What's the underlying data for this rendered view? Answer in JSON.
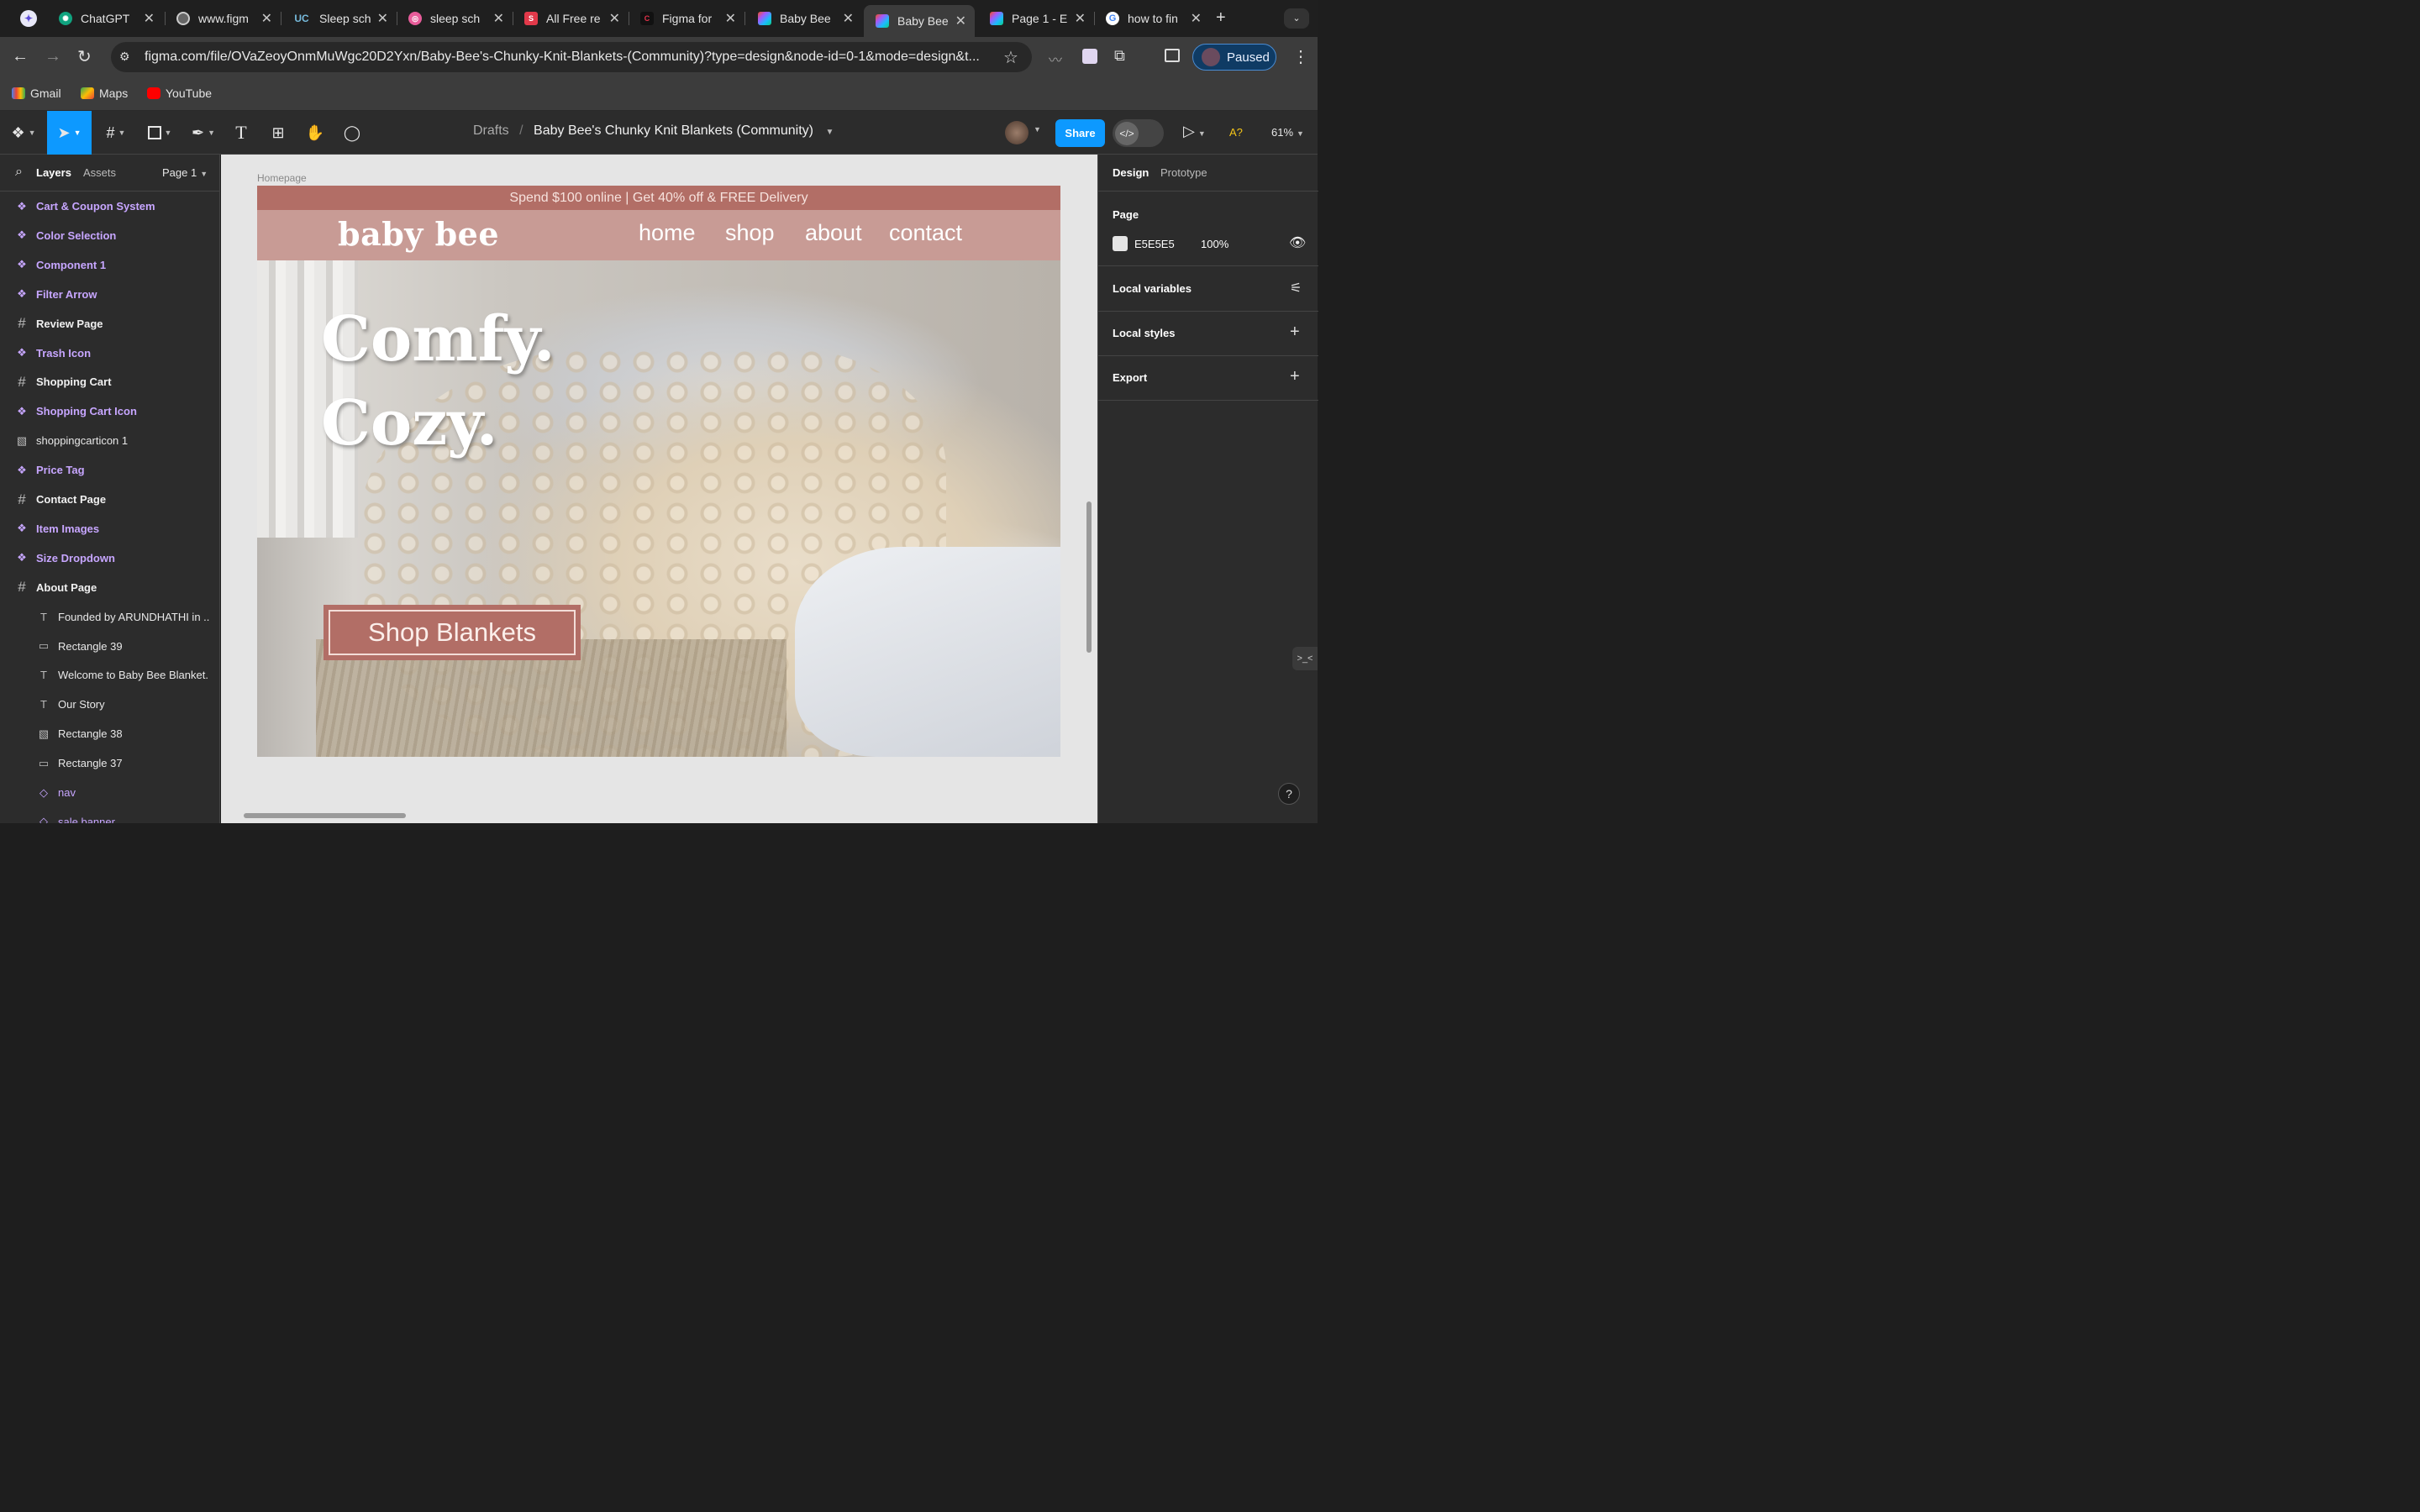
{
  "browser": {
    "tabs": [
      {
        "title": "ChatGPT",
        "color": "#10a37f"
      },
      {
        "title": "www.figm",
        "color": "#777777"
      },
      {
        "title": "Sleep sch",
        "color": "#1c1c1c"
      },
      {
        "title": "sleep sch",
        "color": "#e85c9a"
      },
      {
        "title": "All Free re",
        "color": "#e2394a"
      },
      {
        "title": "Figma for",
        "color": "#1a1a1a"
      },
      {
        "title": "Baby Bee",
        "color": "#a259ff"
      },
      {
        "title": "Baby Bee",
        "color": "#a259ff"
      },
      {
        "title": "Page 1 - E",
        "color": "#a259ff"
      },
      {
        "title": "how to fin",
        "color": "#4285f4"
      }
    ],
    "url": "figma.com/file/OVaZeoyOnmMuWgc20D2Yxn/Baby-Bee's-Chunky-Knit-Blankets-(Community)?type=design&node-id=0-1&mode=design&t...",
    "profile_status": "Paused",
    "bookmarks": [
      "Gmail",
      "Maps",
      "YouTube"
    ]
  },
  "figma": {
    "breadcrumb_root": "Drafts",
    "breadcrumb_sep": "/",
    "file_name": "Baby Bee's Chunky Knit Blankets (Community)",
    "share_label": "Share",
    "ai_label": "A?",
    "zoom": "61%",
    "left_tabs": {
      "layers": "Layers",
      "assets": "Assets",
      "page": "Page 1"
    },
    "layers": [
      {
        "name": "Cart & Coupon System",
        "icon": "component",
        "style": "purple"
      },
      {
        "name": "Color Selection",
        "icon": "component",
        "style": "purple"
      },
      {
        "name": "Component 1",
        "icon": "component",
        "style": "purple"
      },
      {
        "name": "Filter Arrow",
        "icon": "component",
        "style": "purple"
      },
      {
        "name": "Review Page",
        "icon": "frame",
        "style": "white"
      },
      {
        "name": "Trash Icon",
        "icon": "component",
        "style": "purple"
      },
      {
        "name": "Shopping Cart",
        "icon": "frame",
        "style": "white"
      },
      {
        "name": "Shopping Cart Icon",
        "icon": "component",
        "style": "purple"
      },
      {
        "name": "shoppingcarticon 1",
        "icon": "image",
        "style": "normal"
      },
      {
        "name": "Price Tag",
        "icon": "component",
        "style": "purple"
      },
      {
        "name": "Contact Page",
        "icon": "frame",
        "style": "white"
      },
      {
        "name": "Item Images",
        "icon": "component",
        "style": "purple"
      },
      {
        "name": "Size Dropdown",
        "icon": "component",
        "style": "purple"
      },
      {
        "name": "About Page",
        "icon": "frame",
        "style": "white"
      },
      {
        "name": "Founded by ARUNDHATHI in ...",
        "icon": "text",
        "style": "normal",
        "indent": true
      },
      {
        "name": "Rectangle 39",
        "icon": "rect",
        "style": "normal",
        "indent": true
      },
      {
        "name": "Welcome to Baby Bee Blanket...",
        "icon": "text",
        "style": "normal",
        "indent": true
      },
      {
        "name": "Our Story",
        "icon": "text",
        "style": "normal",
        "indent": true
      },
      {
        "name": "Rectangle 38",
        "icon": "image",
        "style": "normal",
        "indent": true
      },
      {
        "name": "Rectangle 37",
        "icon": "rect",
        "style": "normal",
        "indent": true
      },
      {
        "name": "nav",
        "icon": "instance",
        "style": "purple-plain",
        "indent": true
      },
      {
        "name": "sale banner",
        "icon": "instance",
        "style": "purple-plain",
        "indent": true
      }
    ],
    "right": {
      "tab_design": "Design",
      "tab_prototype": "Prototype",
      "page_label": "Page",
      "bg_hex": "E5E5E5",
      "bg_opacity": "100%",
      "local_variables": "Local variables",
      "local_styles": "Local styles",
      "export": "Export"
    },
    "canvas": {
      "frame_label": "Homepage",
      "banner": "Spend $100 online | Get 40% off & FREE Delivery",
      "logo": "baby bee",
      "nav": [
        "home",
        "shop",
        "about",
        "contact"
      ],
      "headline1": "Comfy.",
      "headline2": "Cozy.",
      "cta": "Shop Blankets"
    },
    "colors": {
      "banner": "#b26e66",
      "nav": "#c89b95",
      "cta": "#b26e66",
      "share": "#0d99ff",
      "component": "#c7a6ff"
    }
  }
}
